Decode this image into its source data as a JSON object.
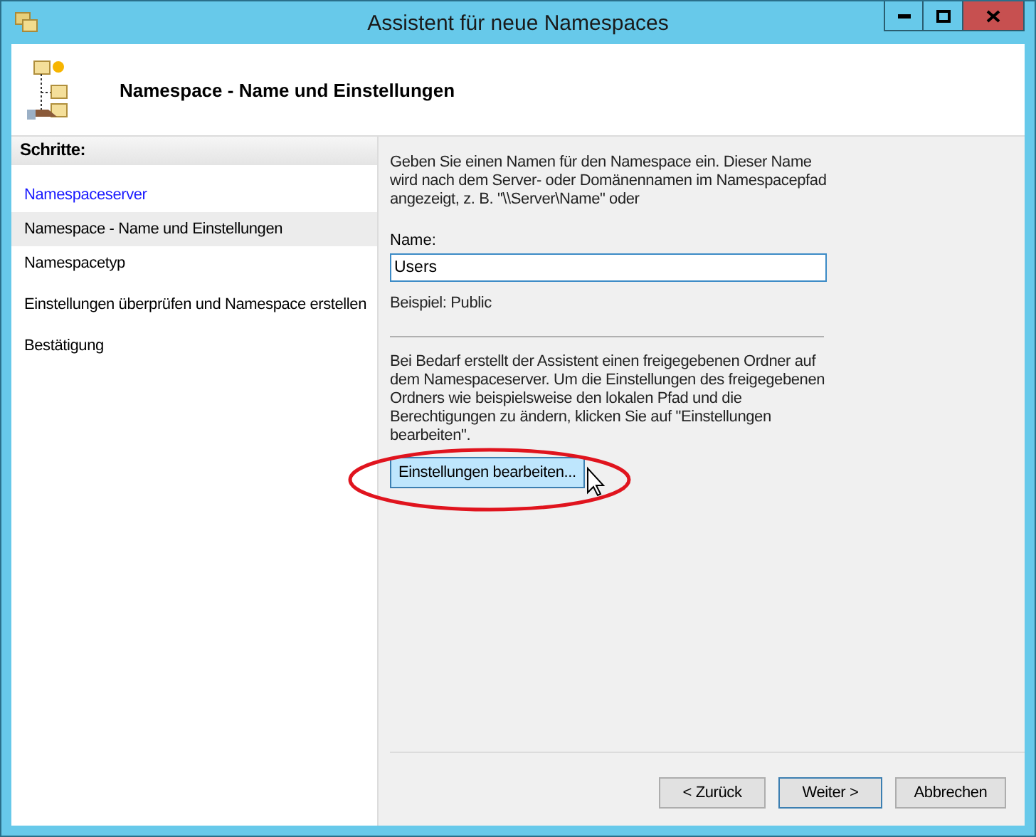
{
  "window": {
    "title": "Assistent für neue Namespaces"
  },
  "header": {
    "title": "Namespace - Name und Einstellungen"
  },
  "steps": {
    "heading": "Schritte:",
    "items": [
      {
        "label": "Namespaceserver",
        "completed": true,
        "selected": false
      },
      {
        "label": "Namespace - Name und Einstellungen",
        "completed": false,
        "selected": true
      },
      {
        "label": "Namespacetyp",
        "completed": false,
        "selected": false
      },
      {
        "label": "Einstellungen überprüfen und Namespace erstellen",
        "completed": false,
        "selected": false
      },
      {
        "label": "Bestätigung",
        "completed": false,
        "selected": false
      }
    ]
  },
  "content": {
    "intro": "Geben Sie einen Namen für den Namespace ein. Dieser Name wird nach dem Server- oder Domänennamen im Namespacepfad angezeigt, z. B. \"\\\\Server\\Name\" oder",
    "name_label": "Name:",
    "name_value": "Users",
    "example": "Beispiel: Public",
    "info": "Bei Bedarf erstellt der Assistent einen freigegebenen Ordner auf dem Namespaceserver. Um die Einstellungen des freigegebenen Ordners wie beispielsweise den lokalen Pfad und die Berechtigungen zu ändern, klicken Sie auf \"Einstellungen bearbeiten\".",
    "edit_button": "Einstellungen bearbeiten..."
  },
  "buttons": [
    {
      "label": "< Zurück",
      "default": false
    },
    {
      "label": "Weiter >",
      "default": true
    },
    {
      "label": "Abbrechen",
      "default": false
    }
  ]
}
